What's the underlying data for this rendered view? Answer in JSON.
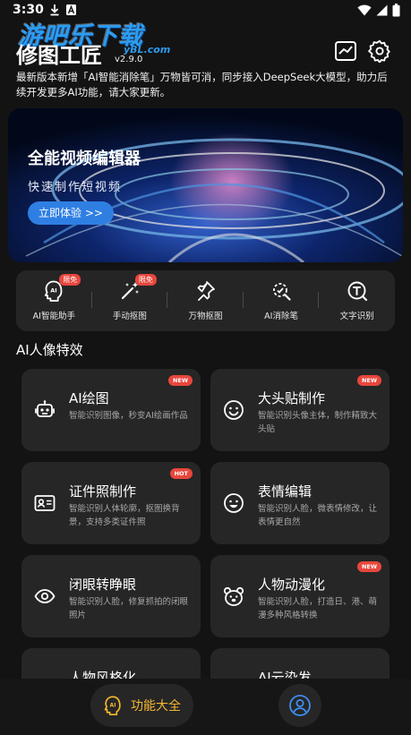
{
  "status_bar": {
    "time": "3:30"
  },
  "watermark": {
    "text": "游吧乐下载",
    "sub": "yBL.com"
  },
  "header": {
    "title": "修图工匠",
    "version": "v2.9.0",
    "chart_icon": "chart-icon",
    "settings_icon": "gear-icon"
  },
  "notice": "最新版本新增「AI智能消除笔」万物皆可消，同步接入DeepSeek大模型，助力后续开发更多AI功能，请大家更新。",
  "banner": {
    "title": "全能视频编辑器",
    "subtitle": "快速制作短视频",
    "cta": "立即体验 >>"
  },
  "tools": [
    {
      "label": "AI智能助手",
      "badge": "限免",
      "icon": "ai-head-icon"
    },
    {
      "label": "手动抠图",
      "badge": "限免",
      "icon": "magic-wand-icon"
    },
    {
      "label": "万物抠图",
      "badge": "",
      "icon": "pin-icon"
    },
    {
      "label": "AI消除笔",
      "badge": "",
      "icon": "eraser-scan-icon"
    },
    {
      "label": "文字识别",
      "badge": "",
      "icon": "text-recognition-icon"
    }
  ],
  "section_title": "AI人像特效",
  "cards": [
    {
      "title": "AI绘图",
      "desc": "智能识别图像，秒变AI绘画作品",
      "badge": "NEW",
      "icon": "robot-icon"
    },
    {
      "title": "大头贴制作",
      "desc": "智能识别头像主体，制作精致大头贴",
      "badge": "NEW",
      "icon": "smile-icon"
    },
    {
      "title": "证件照制作",
      "desc": "智能识别人体轮廓，抠图换背景，支持多类证件照",
      "badge": "HOT",
      "icon": "id-card-icon"
    },
    {
      "title": "表情编辑",
      "desc": "智能识别人脸，微表情修改，让表情更自然",
      "badge": "",
      "icon": "emoji-icon"
    },
    {
      "title": "闭眼转睁眼",
      "desc": "智能识别人脸，修复抓拍的闭眼照片",
      "badge": "",
      "icon": "eye-icon"
    },
    {
      "title": "人物动漫化",
      "desc": "智能识别人脸，打造日、港、萌漫多种风格转换",
      "badge": "NEW",
      "icon": "bear-icon"
    },
    {
      "title": "人物风格化",
      "desc": "",
      "badge": "",
      "icon": ""
    },
    {
      "title": "AI云染发",
      "desc": "",
      "badge": "",
      "icon": ""
    }
  ],
  "bottom_nav": {
    "features_label": "功能大全",
    "features_icon": "ai-head-icon",
    "profile_icon": "user-icon",
    "accent": "#f5b82e"
  },
  "colors": {
    "background": "#131313",
    "card": "#262626",
    "badge": "#e8463d",
    "cta": "#2f7fe3"
  }
}
